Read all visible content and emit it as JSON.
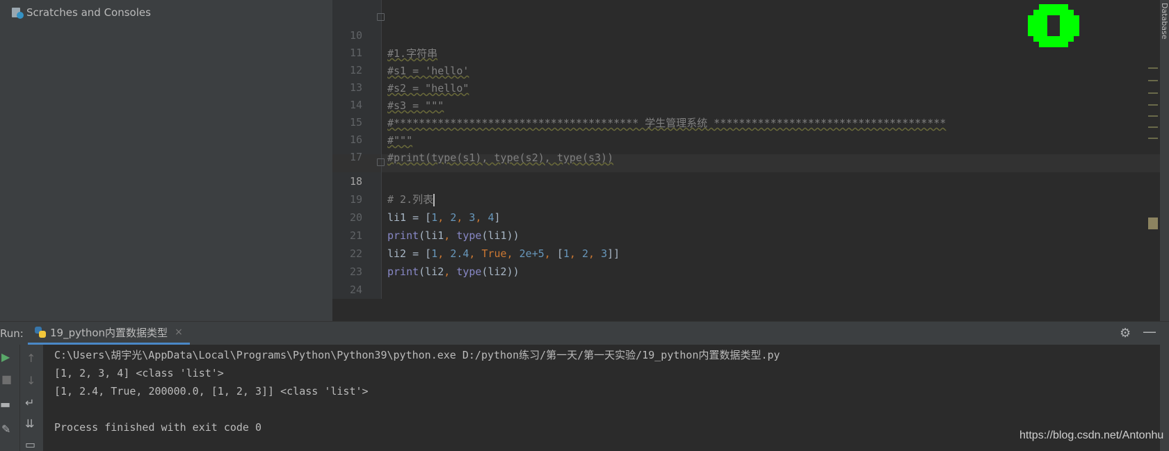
{
  "project": {
    "item_label": "Scratches and Consoles"
  },
  "editor": {
    "lines": [
      {
        "num": "10",
        "text": "#1.字符串"
      },
      {
        "num": "11",
        "text": "#s1 = 'hello'"
      },
      {
        "num": "12",
        "text": "#s2 = \"hello\""
      },
      {
        "num": "13",
        "text": "#s3 = \"\"\""
      },
      {
        "num": "14",
        "text": "#*************************************** 学生管理系统 *************************************"
      },
      {
        "num": "15",
        "text": "#\"\"\""
      },
      {
        "num": "16",
        "text": "#print(type(s1), type(s2), type(s3))"
      },
      {
        "num": "17",
        "text": ""
      },
      {
        "num": "18",
        "text": "# 2.列表"
      },
      {
        "num": "19",
        "text": ""
      },
      {
        "num": "20",
        "text": ""
      },
      {
        "num": "21",
        "text": ""
      },
      {
        "num": "22",
        "text": ""
      },
      {
        "num": "23",
        "text": ""
      },
      {
        "num": "24",
        "text": ""
      }
    ],
    "l19": {
      "a": "li1 = [",
      "n1": "1",
      "c1": ", ",
      "n2": "2",
      "c2": ", ",
      "n3": "3",
      "c3": ", ",
      "n4": "4",
      "e": "]"
    },
    "l20": {
      "f": "print",
      "o": "(li1",
      "c": ", ",
      "t": "type",
      "r": "(li1))"
    },
    "l21": {
      "a": "li2 = [",
      "n1": "1",
      "c1": ", ",
      "n2": "2.4",
      "c2": ", ",
      "k": "True",
      "c3": ", ",
      "n3": "2e+5",
      "c4": ", ",
      "b": "[",
      "n4": "1",
      "c5": ", ",
      "n5": "2",
      "c6": ", ",
      "n6": "3",
      "e": "]]"
    },
    "l22": {
      "f": "print",
      "o": "(li2",
      "c": ", ",
      "t": "type",
      "r": "(li2))"
    },
    "right_strip_label": "Database"
  },
  "run": {
    "label": "Run:",
    "tab_label": "19_python内置数据类型",
    "tab_close": "×",
    "output": [
      "C:\\Users\\胡宇光\\AppData\\Local\\Programs\\Python\\Python39\\python.exe D:/python练习/第一天/第一天实验/19_python内置数据类型.py",
      "[1, 2, 3, 4] <class 'list'>",
      "[1, 2.4, True, 200000.0, [1, 2, 3]] <class 'list'>",
      "",
      "Process finished with exit code 0"
    ]
  },
  "watermark": "https://blog.csdn.net/Antonhu",
  "colors": {
    "accent": "#4a88c7",
    "inspection": "#00ff00"
  }
}
